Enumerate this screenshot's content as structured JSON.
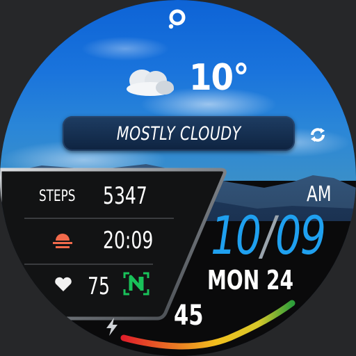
{
  "weather": {
    "temperature": "10°",
    "condition": "MOSTLY CLOUDY",
    "icon": "cloud-icon"
  },
  "stats": {
    "steps_label": "STEPS",
    "steps_value": "5347",
    "sunset_icon": "sunset-icon",
    "sunset_time": "20:09",
    "heart_icon": "heart-icon",
    "heart_rate": "75"
  },
  "clock": {
    "ampm": "AM",
    "hours": "10",
    "separator": "/",
    "minutes": "09",
    "date": "MON 24"
  },
  "battery": {
    "icon": "lightning-icon",
    "level": 45,
    "level_text": "45"
  },
  "colors": {
    "time_blue": "#1fa0ef",
    "sky_blue": "#1a74dc",
    "accent_green": "#19c25a",
    "gauge": [
      "#e0202a",
      "#f2c01e",
      "#2e9e3a"
    ]
  }
}
